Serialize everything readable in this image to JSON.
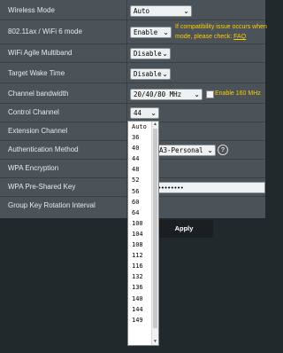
{
  "rows": [
    {
      "label": "Wireless Mode",
      "value": "Auto"
    },
    {
      "label": "802.11ax / WiFi 6 mode",
      "value": "Enable",
      "note_line1": "If compatibility issue occurs when",
      "note_line2": "mode, please check: ",
      "note_link": "FAQ"
    },
    {
      "label": "WiFi Agile Multiband",
      "value": "Disable"
    },
    {
      "label": "Target Wake Time",
      "value": "Disable"
    },
    {
      "label": "Channel bandwidth",
      "value": "20/40/80 MHz",
      "checkbox_label": "Enable 160 MHz"
    },
    {
      "label": "Control Channel",
      "value": "44"
    },
    {
      "label": "Extension Channel",
      "value": ""
    },
    {
      "label": "Authentication Method",
      "value": "A3-Personal"
    },
    {
      "label": "WPA Encryption",
      "value": ""
    },
    {
      "label": "WPA Pre-Shared Key",
      "value": "••••••••"
    },
    {
      "label": "Group Key Rotation Interval",
      "value": ""
    }
  ],
  "apply_label": "Apply",
  "channel_options": [
    "Auto",
    "36",
    "40",
    "44",
    "48",
    "52",
    "56",
    "60",
    "64",
    "100",
    "104",
    "108",
    "112",
    "116",
    "132",
    "136",
    "140",
    "144",
    "149"
  ],
  "help_icon": "?"
}
